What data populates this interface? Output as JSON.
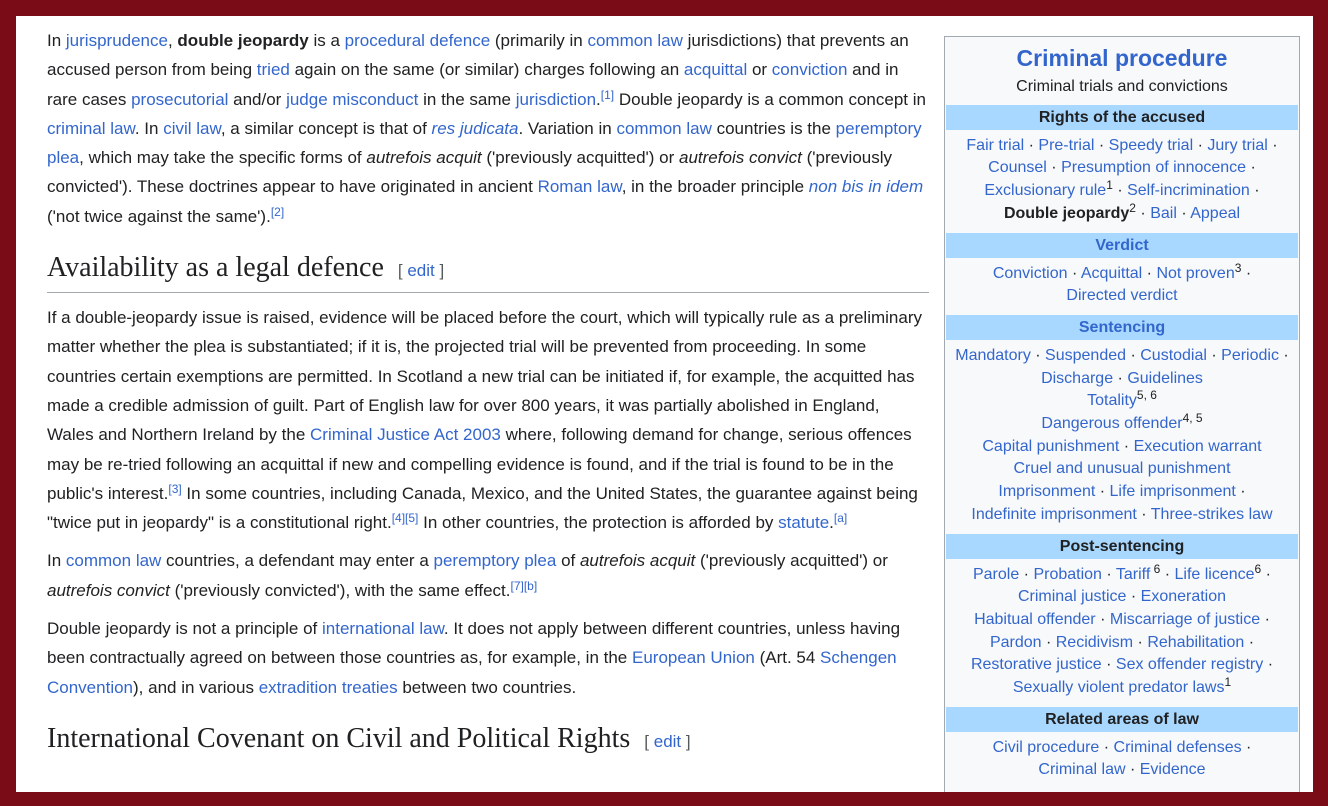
{
  "intro": {
    "p1": [
      {
        "t": "In "
      },
      {
        "t": "jurisprudence",
        "link": true
      },
      {
        "t": ", "
      },
      {
        "t": "double jeopardy",
        "bold": true
      },
      {
        "t": " is a "
      },
      {
        "t": "procedural defence",
        "link": true
      },
      {
        "t": " (primarily in "
      },
      {
        "t": "common law",
        "link": true
      },
      {
        "t": " jurisdictions) that prevents an accused person from being "
      },
      {
        "t": "tried",
        "link": true
      },
      {
        "t": " again on the same (or similar) charges following an "
      },
      {
        "t": "acquittal",
        "link": true
      },
      {
        "t": " or "
      },
      {
        "t": "conviction",
        "link": true
      },
      {
        "t": " and in rare cases "
      },
      {
        "t": "prosecutorial",
        "link": true
      },
      {
        "t": " and/or "
      },
      {
        "t": "judge misconduct",
        "link": true
      },
      {
        "t": " in the same "
      },
      {
        "t": "jurisdiction",
        "link": true
      },
      {
        "t": "."
      },
      {
        "t": "[1]",
        "sup": true,
        "link": true
      },
      {
        "t": " Double jeopardy is a common concept in "
      },
      {
        "t": "criminal law",
        "link": true
      },
      {
        "t": ". In "
      },
      {
        "t": "civil law",
        "link": true
      },
      {
        "t": ", a similar concept is that of "
      },
      {
        "t": "res judicata",
        "link": true,
        "italic": true
      },
      {
        "t": ". Variation in "
      },
      {
        "t": "common law",
        "link": true
      },
      {
        "t": " countries is the "
      },
      {
        "t": "peremptory plea",
        "link": true
      },
      {
        "t": ", which may take the specific forms of "
      },
      {
        "t": "autrefois acquit",
        "italic": true
      },
      {
        "t": " ('previously acquitted') or "
      },
      {
        "t": "autrefois convict",
        "italic": true
      },
      {
        "t": " ('previously convicted'). These doctrines appear to have originated in ancient "
      },
      {
        "t": "Roman law",
        "link": true
      },
      {
        "t": ", in the broader principle "
      },
      {
        "t": "non bis in idem",
        "link": true,
        "italic": true
      },
      {
        "t": " ('not twice against the same')."
      },
      {
        "t": "[2]",
        "sup": true,
        "link": true
      }
    ]
  },
  "section1": {
    "heading": "Availability as a legal defence",
    "edit_label": "edit",
    "bracket_open": "[",
    "bracket_close": "]",
    "p1": [
      {
        "t": "If a double-jeopardy issue is raised, evidence will be placed before the court, which will typically rule as a preliminary matter whether the plea is substantiated; if it is, the projected trial will be prevented from proceeding. In some countries certain exemptions are permitted. In Scotland a new trial can be initiated if, for example, the acquitted has made a credible admission of guilt. Part of English law for over 800 years, it was partially abolished in England, Wales and Northern Ireland by the "
      },
      {
        "t": "Criminal Justice Act 2003",
        "link": true
      },
      {
        "t": " where, following demand for change, serious offences may be re-tried following an acquittal if new and compelling evidence is found, and if the trial is found to be in the public's interest."
      },
      {
        "t": "[3]",
        "sup": true,
        "link": true
      },
      {
        "t": " In some countries, including Canada, Mexico, and the United States, the guarantee against being \"twice put in jeopardy\" is a constitutional right."
      },
      {
        "t": "[4]",
        "sup": true,
        "link": true
      },
      {
        "t": "[5]",
        "sup": true,
        "link": true
      },
      {
        "t": " In other countries, the protection is afforded by "
      },
      {
        "t": "statute",
        "link": true
      },
      {
        "t": "."
      },
      {
        "t": "[a]",
        "sup": true,
        "link": true
      }
    ],
    "p2": [
      {
        "t": "In "
      },
      {
        "t": "common law",
        "link": true
      },
      {
        "t": " countries, a defendant may enter a "
      },
      {
        "t": "peremptory plea",
        "link": true
      },
      {
        "t": " of "
      },
      {
        "t": "autrefois acquit",
        "italic": true
      },
      {
        "t": " ('previously acquitted') or "
      },
      {
        "t": "autrefois convict",
        "italic": true
      },
      {
        "t": " ('previously convicted'), with the same effect."
      },
      {
        "t": "[7]",
        "sup": true,
        "link": true
      },
      {
        "t": "[b]",
        "sup": true,
        "link": true
      }
    ],
    "p3": [
      {
        "t": "Double jeopardy is not a principle of "
      },
      {
        "t": "international law",
        "link": true
      },
      {
        "t": ". It does not apply between different countries, unless having been contractually agreed on between those countries as, for example, in the "
      },
      {
        "t": "European Union",
        "link": true
      },
      {
        "t": " (Art. 54 "
      },
      {
        "t": "Schengen Convention",
        "link": true
      },
      {
        "t": "), and in various "
      },
      {
        "t": "extradition treaties",
        "link": true
      },
      {
        "t": " between two countries."
      }
    ]
  },
  "section2": {
    "heading": "International Covenant on Civil and Political Rights",
    "edit_label": "edit",
    "bracket_open": "[",
    "bracket_close": "]"
  },
  "infobox": {
    "title": "Criminal procedure",
    "subtitle": "Criminal trials and convictions",
    "sections": [
      {
        "heading": "Rights of the accused",
        "heading_is_link": false,
        "lines": [
          [
            {
              "t": "Fair trial",
              "link": true
            },
            {
              "t": " · "
            },
            {
              "t": "Pre-trial",
              "link": true
            },
            {
              "t": " · "
            },
            {
              "t": "Speedy trial",
              "link": true
            },
            {
              "t": " · "
            },
            {
              "t": "Jury trial",
              "link": true
            },
            {
              "t": " ·"
            }
          ],
          [
            {
              "t": "Counsel",
              "link": true
            },
            {
              "t": " · "
            },
            {
              "t": "Presumption of innocence",
              "link": true
            },
            {
              "t": " ·"
            }
          ],
          [
            {
              "t": "Exclusionary rule",
              "link": true
            },
            {
              "t": "1",
              "sup": true
            },
            {
              "t": " · "
            },
            {
              "t": "Self-incrimination",
              "link": true
            },
            {
              "t": " ·"
            }
          ],
          [
            {
              "t": "Double jeopardy",
              "bold": true
            },
            {
              "t": "2",
              "sup": true
            },
            {
              "t": " · "
            },
            {
              "t": "Bail",
              "link": true
            },
            {
              "t": " · "
            },
            {
              "t": "Appeal",
              "link": true
            }
          ]
        ]
      },
      {
        "heading": "Verdict",
        "heading_is_link": true,
        "lines": [
          [
            {
              "t": "Conviction",
              "link": true
            },
            {
              "t": " · "
            },
            {
              "t": "Acquittal",
              "link": true
            },
            {
              "t": " · "
            },
            {
              "t": "Not proven",
              "link": true
            },
            {
              "t": "3",
              "sup": true
            },
            {
              "t": " ·"
            }
          ],
          [
            {
              "t": "Directed verdict",
              "link": true
            }
          ]
        ]
      },
      {
        "heading": "Sentencing",
        "heading_is_link": true,
        "lines": [
          [
            {
              "t": "Mandatory",
              "link": true
            },
            {
              "t": " · "
            },
            {
              "t": "Suspended",
              "link": true
            },
            {
              "t": " · "
            },
            {
              "t": "Custodial",
              "link": true
            },
            {
              "t": " · "
            },
            {
              "t": "Periodic",
              "link": true
            },
            {
              "t": " ·"
            }
          ],
          [
            {
              "t": "Discharge",
              "link": true
            },
            {
              "t": " · "
            },
            {
              "t": "Guidelines",
              "link": true
            }
          ],
          [
            {
              "t": "Totality",
              "link": true
            },
            {
              "t": "5, 6",
              "sup": true
            }
          ],
          [
            {
              "t": "Dangerous offender",
              "link": true
            },
            {
              "t": "4, 5",
              "sup": true
            }
          ],
          [
            {
              "t": "Capital punishment",
              "link": true
            },
            {
              "t": " · "
            },
            {
              "t": "Execution warrant",
              "link": true
            }
          ],
          [
            {
              "t": "Cruel and unusual punishment",
              "link": true
            }
          ],
          [
            {
              "t": "Imprisonment",
              "link": true
            },
            {
              "t": " · "
            },
            {
              "t": "Life imprisonment",
              "link": true
            },
            {
              "t": " ·"
            }
          ],
          [
            {
              "t": "Indefinite imprisonment",
              "link": true
            },
            {
              "t": " · "
            },
            {
              "t": "Three-strikes law",
              "link": true
            }
          ]
        ]
      },
      {
        "heading": "Post-sentencing",
        "heading_is_link": false,
        "lines": [
          [
            {
              "t": "Parole",
              "link": true
            },
            {
              "t": " · "
            },
            {
              "t": "Probation",
              "link": true
            },
            {
              "t": " · "
            },
            {
              "t": "Tariff",
              "link": true
            },
            {
              "t": " 6",
              "sup": true
            },
            {
              "t": " · "
            },
            {
              "t": "Life licence",
              "link": true
            },
            {
              "t": "6",
              "sup": true
            },
            {
              "t": " ·"
            }
          ],
          [
            {
              "t": "Criminal justice",
              "link": true
            },
            {
              "t": " · "
            },
            {
              "t": "Exoneration",
              "link": true
            }
          ],
          [
            {
              "t": "Habitual offender",
              "link": true
            },
            {
              "t": " · "
            },
            {
              "t": "Miscarriage of justice",
              "link": true
            },
            {
              "t": " ·"
            }
          ],
          [
            {
              "t": "Pardon",
              "link": true
            },
            {
              "t": " · "
            },
            {
              "t": "Recidivism",
              "link": true
            },
            {
              "t": " · "
            },
            {
              "t": "Rehabilitation",
              "link": true
            },
            {
              "t": " ·"
            }
          ],
          [
            {
              "t": "Restorative justice",
              "link": true
            },
            {
              "t": " · "
            },
            {
              "t": "Sex offender registry",
              "link": true
            },
            {
              "t": " ·"
            }
          ],
          [
            {
              "t": "Sexually violent predator laws",
              "link": true
            },
            {
              "t": "1",
              "sup": true
            }
          ]
        ]
      },
      {
        "heading": "Related areas of law",
        "heading_is_link": false,
        "lines": [
          [
            {
              "t": "Civil procedure",
              "link": true
            },
            {
              "t": " · "
            },
            {
              "t": "Criminal defenses",
              "link": true
            },
            {
              "t": " ·"
            }
          ],
          [
            {
              "t": "Criminal law",
              "link": true
            },
            {
              "t": " · "
            },
            {
              "t": "Evidence",
              "link": true
            }
          ]
        ]
      }
    ]
  },
  "colors": {
    "link": "#3366cc",
    "frame": "#7a0c17",
    "infobox_header": "#a8d8ff",
    "infobox_bg": "#f8f9fa",
    "text": "#202122"
  }
}
